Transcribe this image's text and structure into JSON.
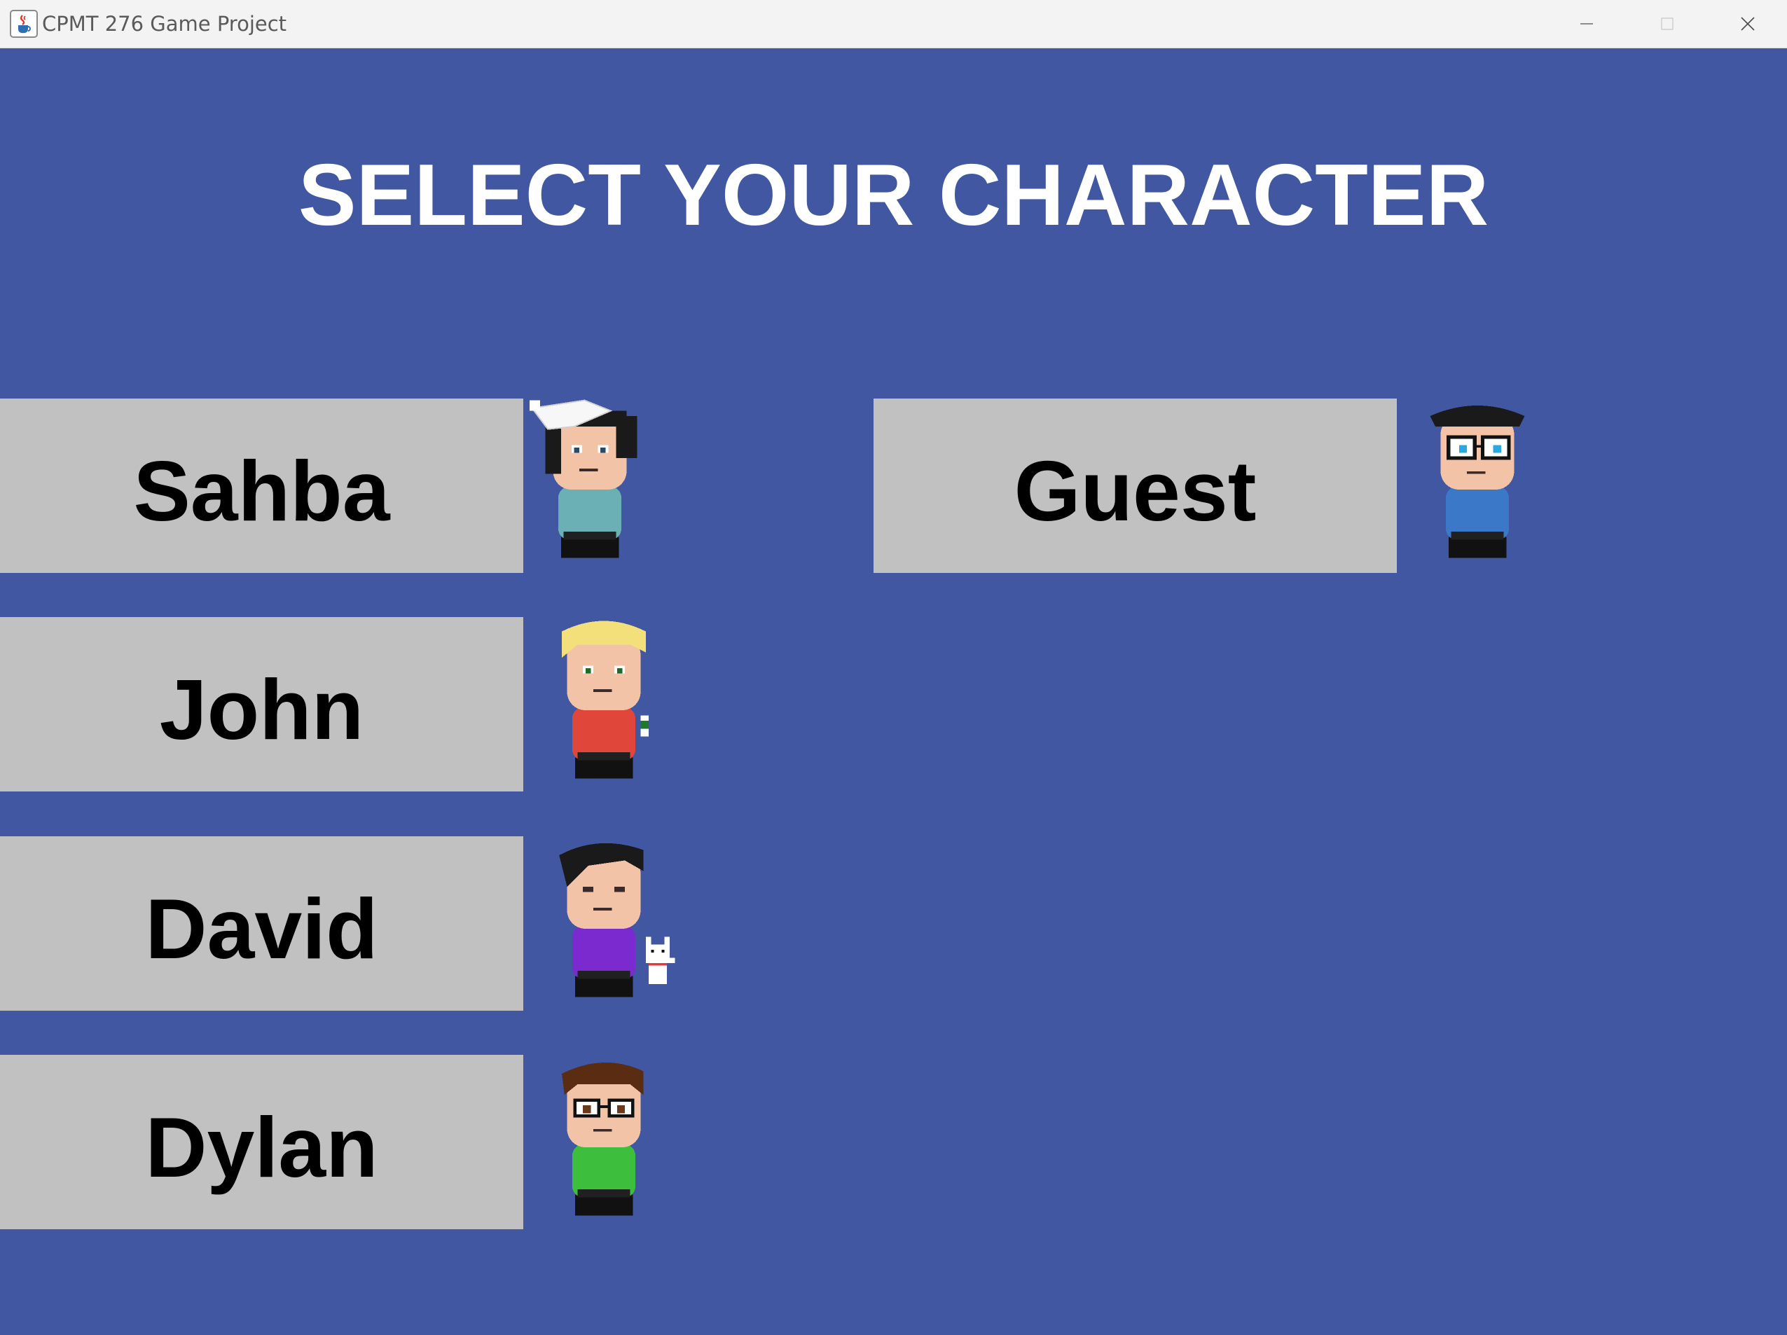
{
  "window": {
    "title": "CPMT 276 Game Project",
    "icon": "java-cup-icon",
    "controls": [
      "minimize-icon",
      "maximize-icon",
      "close-icon"
    ]
  },
  "screen": {
    "heading": "SELECT YOUR CHARACTER",
    "background_color": "#4157a1",
    "button_color": "#c1c1c1"
  },
  "characters": [
    {
      "name": "Sahba",
      "shirt_color": "#6ab0b4",
      "hair": "black with white hat"
    },
    {
      "name": "John",
      "shirt_color": "#e0473a",
      "hair": "blonde"
    },
    {
      "name": "David",
      "shirt_color": "#7b2ad0",
      "hair": "black"
    },
    {
      "name": "Dylan",
      "shirt_color": "#3dbf3d",
      "hair": "brown"
    },
    {
      "name": "Guest",
      "shirt_color": "#3b78c8",
      "hair": "black"
    }
  ]
}
